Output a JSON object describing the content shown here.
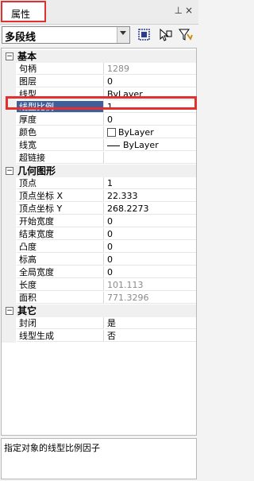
{
  "panel": {
    "tab_label": "属性",
    "pin_icon": "pin-icon",
    "close_icon": "close-icon"
  },
  "selector": {
    "value": "多段线"
  },
  "toolbar_icons": [
    "quick-select-icon",
    "select-objects-icon",
    "pickadd-filter-icon"
  ],
  "categories": [
    {
      "label": "基本",
      "toggle": "⊟"
    },
    {
      "label": "几何图形",
      "toggle": "⊟"
    },
    {
      "label": "其它",
      "toggle": "⊟"
    }
  ],
  "basic": [
    {
      "name": "句柄",
      "value": "1289"
    },
    {
      "name": "图层",
      "value": "0"
    },
    {
      "name": "线型",
      "value": "ByLayer"
    },
    {
      "name": "线型比例",
      "value": "1"
    },
    {
      "name": "厚度",
      "value": "0"
    },
    {
      "name": "颜色",
      "value": "ByLayer"
    },
    {
      "name": "线宽",
      "value": "ByLayer"
    },
    {
      "name": "超链接",
      "value": ""
    }
  ],
  "geometry": [
    {
      "name": "顶点",
      "value": "1"
    },
    {
      "name": "顶点坐标 X",
      "value": "22.333"
    },
    {
      "name": "顶点坐标 Y",
      "value": "268.2273"
    },
    {
      "name": "开始宽度",
      "value": "0"
    },
    {
      "name": "结束宽度",
      "value": "0"
    },
    {
      "name": "凸度",
      "value": "0"
    },
    {
      "name": "标高",
      "value": "0"
    },
    {
      "name": "全局宽度",
      "value": "0"
    },
    {
      "name": "长度",
      "value": "101.113"
    },
    {
      "name": "面积",
      "value": "771.3296"
    }
  ],
  "other": [
    {
      "name": "封闭",
      "value": "是"
    },
    {
      "name": "线型生成",
      "value": "否"
    }
  ],
  "description": "指定对象的线型比例因子",
  "colors": {
    "highlight": "#e03030",
    "selection": "#3f5f9a"
  }
}
